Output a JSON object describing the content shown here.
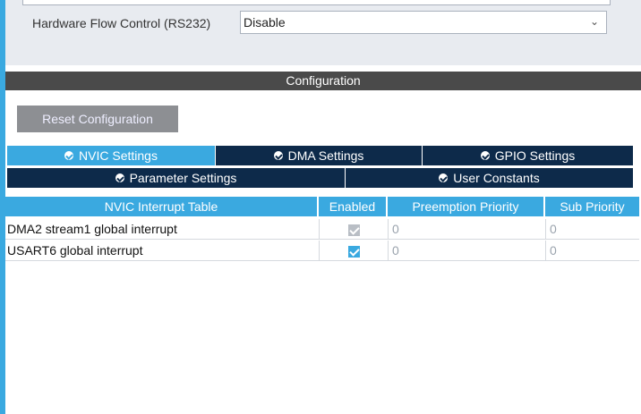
{
  "uart": {
    "hfc_label": "Hardware Flow Control (RS232)",
    "hfc_value": "Disable"
  },
  "config": {
    "title": "Configuration",
    "reset_label": "Reset Configuration",
    "tabs": [
      {
        "label": "NVIC Settings",
        "active": true
      },
      {
        "label": "DMA Settings",
        "active": false
      },
      {
        "label": "GPIO Settings",
        "active": false
      },
      {
        "label": "Parameter Settings",
        "active": false
      },
      {
        "label": "User Constants",
        "active": false
      }
    ]
  },
  "nvic_table": {
    "headers": [
      "NVIC Interrupt Table",
      "Enabled",
      "Preemption Priority",
      "Sub Priority"
    ],
    "rows": [
      {
        "name": "DMA2 stream1 global interrupt",
        "enabled": true,
        "enabled_editable": false,
        "preemption": "0",
        "sub": "0"
      },
      {
        "name": "USART6 global interrupt",
        "enabled": true,
        "enabled_editable": true,
        "preemption": "0",
        "sub": "0"
      }
    ]
  },
  "colors": {
    "accent": "#3aa9e0",
    "tab_dark": "#0d2a4a",
    "config_bar": "#4a4a4a",
    "button_gray": "#8d8f93"
  }
}
